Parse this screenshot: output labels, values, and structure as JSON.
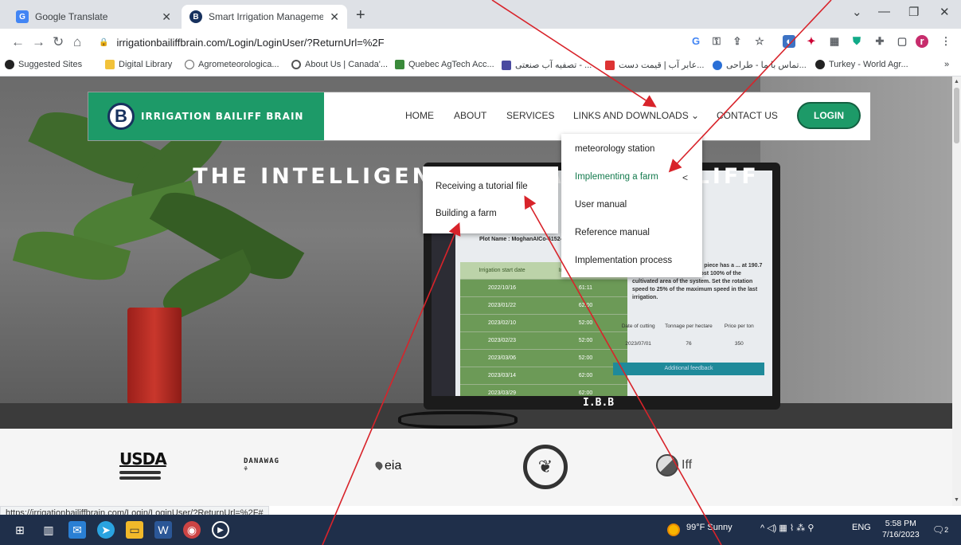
{
  "browser": {
    "tabs": [
      {
        "title": "Google Translate",
        "favicon": "google-translate-icon"
      },
      {
        "title": "Smart Irrigation Management: Ea",
        "favicon": "ibb-logo-icon"
      }
    ],
    "url": "irrigationbailiffbrain.com/Login/LoginUser/?ReturnUrl=%2F",
    "bookmarks": [
      "Suggested Sites",
      "Digital Library",
      "Agrometeorologica...",
      "About Us | Canada'...",
      "Quebec AgTech Acc...",
      "تصفیه آب صنعتی - ...",
      "عابر آب | قیمت دست...",
      "تماس با ما - طراحی...",
      "Turkey - World Agr..."
    ],
    "bookmarks_more": "»",
    "status_url": "https://irrigationbailiffbrain.com/Login/LoginUser/?ReturnUrl=%2F#"
  },
  "site": {
    "logo_text": "IRRIGATION BAILIFF BRAIN",
    "logo_letter": "B",
    "nav": {
      "home": "HOME",
      "about": "ABOUT",
      "services": "SERVICES",
      "links": "LINKS AND DOWNLOADS",
      "contact": "CONTACT US",
      "login": "LOGIN"
    },
    "hero_title": "THE INTELLIGENT IRRIGATION BAILIFF",
    "dropdown": [
      "meteorology station",
      "Implementing a farm",
      "User manual",
      "Reference manual",
      "Implementation process"
    ],
    "submenu": [
      "Receiving a tutorial file",
      "Building a farm"
    ],
    "laptop": {
      "plot_name": "Plot Name : MoghanAICo-6152-Crpt",
      "table_headers": [
        "Irrigation start date",
        "Irrigation duration plot"
      ],
      "rows": [
        [
          "2022/10/16",
          "61:11"
        ],
        [
          "2023/01/22",
          "62:00"
        ],
        [
          "2023/02/10",
          "52:00"
        ],
        [
          "2023/02/23",
          "52:00"
        ],
        [
          "2023/03/06",
          "52:00"
        ],
        [
          "2023/03/14",
          "62:00"
        ],
        [
          "2023/03/29",
          "62:00"
        ]
      ],
      "side_text": "forms the last water ... The piece has a ... at 190.7 degrees. It is equal to almost 100% of the cultivated area of the system. Set the rotation speed to 25% of the maximum speed in the last irrigation.",
      "cut_headers": [
        "Date of cutting",
        "Tonnage per hectare",
        "Price per ton"
      ],
      "cut_row": [
        "2023/07/01",
        "76",
        "350"
      ],
      "feedback_btn": "Additional feedback",
      "brand": "I.B.B"
    },
    "partners": [
      "USDA",
      "DANAWAG",
      "eia",
      "Iff"
    ]
  },
  "taskbar": {
    "weather": "99°F Sunny",
    "lang": "ENG",
    "time": "5:58 PM",
    "date": "7/16/2023",
    "notif_count": "2"
  },
  "colors": {
    "brand_green": "#1d9a68",
    "navy": "#17315e",
    "annotation_red": "#d8232a"
  }
}
